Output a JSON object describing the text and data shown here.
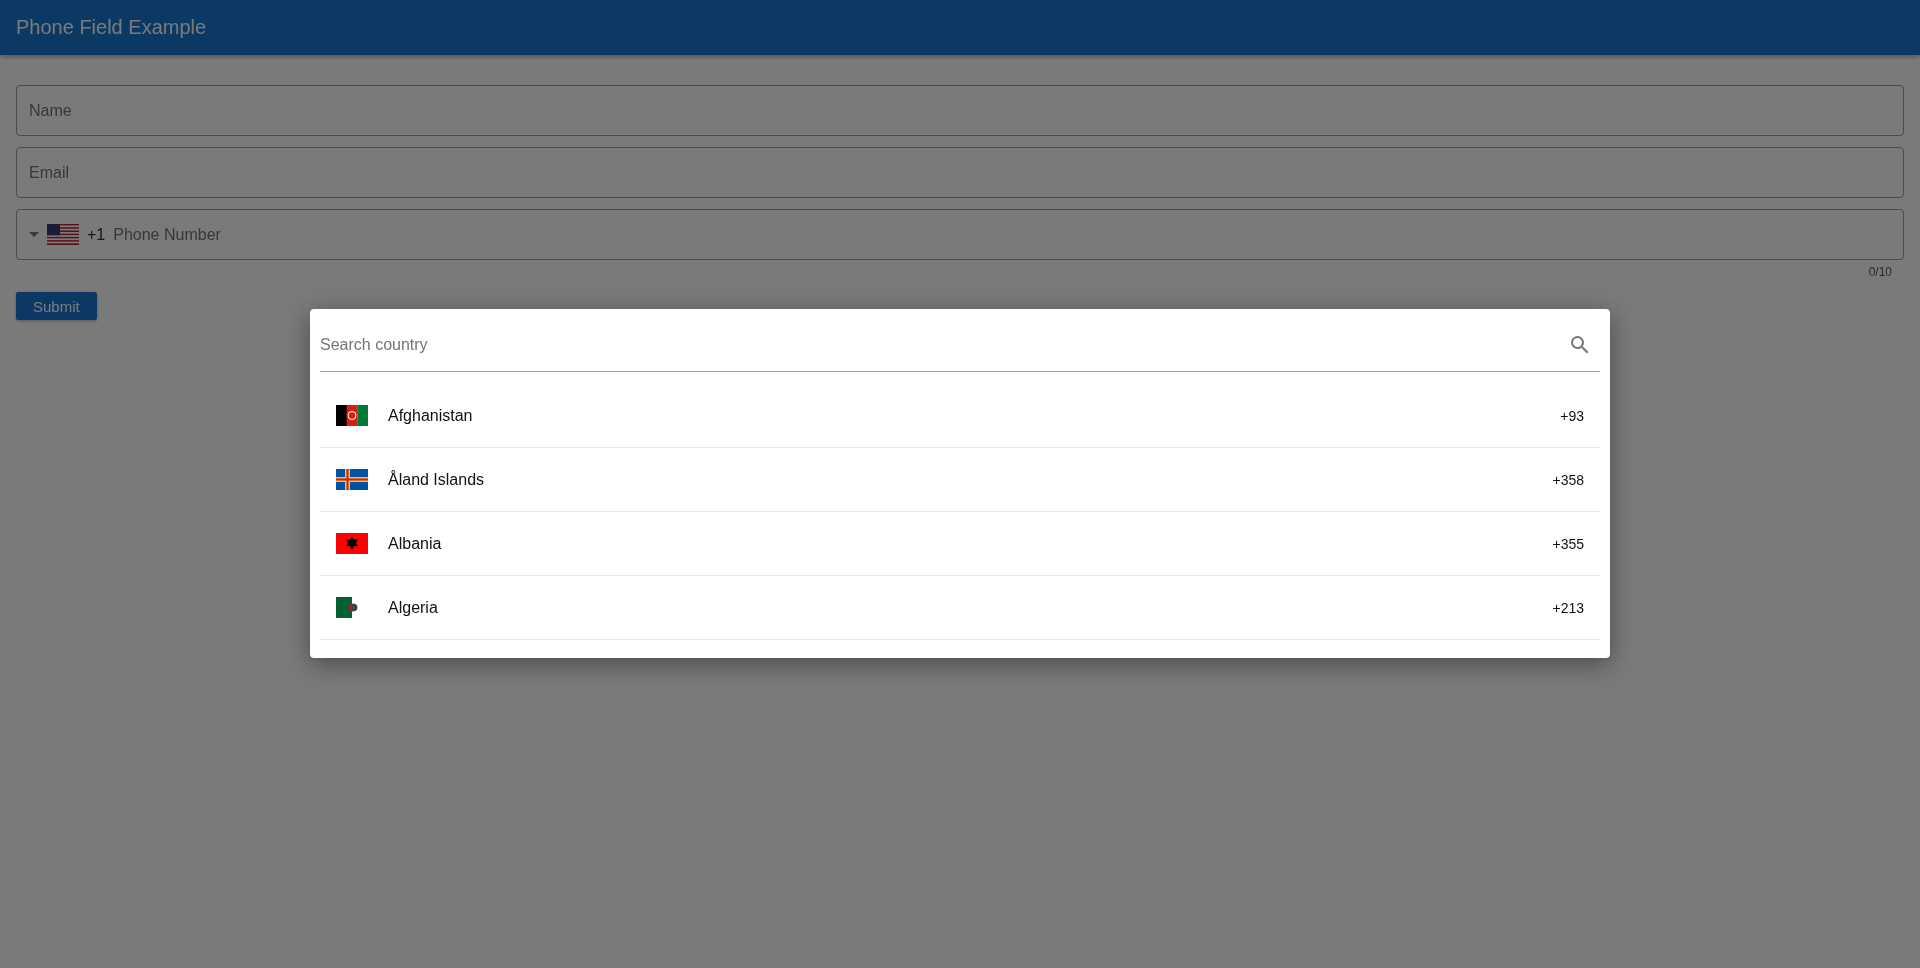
{
  "app_bar": {
    "title": "Phone Field Example"
  },
  "form": {
    "fields": [
      {
        "placeholder": "Name"
      },
      {
        "placeholder": "Email"
      }
    ],
    "phone": {
      "flag": {
        "kind": "us"
      },
      "dial_code": "+1",
      "placeholder": "Phone Number",
      "counter": "0/10"
    },
    "submit": "Submit"
  },
  "dialog": {
    "search": {
      "placeholder": "Search country"
    },
    "countries": [
      {
        "kind": "af",
        "name": "Afghanistan",
        "code": "+93"
      },
      {
        "kind": "ax",
        "name": "Åland Islands",
        "code": "+358"
      },
      {
        "kind": "al",
        "name": "Albania",
        "code": "+355"
      },
      {
        "kind": "dz",
        "name": "Algeria",
        "code": "+213"
      }
    ]
  }
}
